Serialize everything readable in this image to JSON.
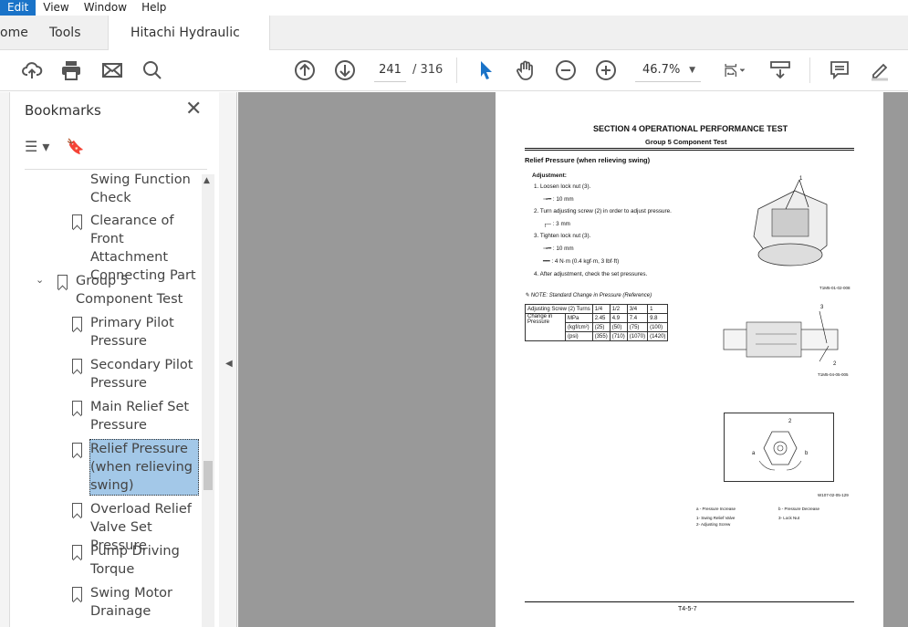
{
  "menu": [
    "Edit",
    "View",
    "Window",
    "Help"
  ],
  "tabs": {
    "home": "ome",
    "tools": "Tools",
    "document": "Hitachi Hydraulic Ex...",
    "close": "×"
  },
  "toolbar": {
    "page_current": "241",
    "page_total": "/ 316",
    "zoom": "46.7%"
  },
  "bookmarks": {
    "title": "Bookmarks",
    "close": "✕",
    "items": [
      "Swing Function Check",
      "Clearance of Front Attachment Connecting Part",
      "Group 5 Component Test",
      "Primary Pilot Pressure",
      "Secondary Pilot Pressure",
      "Main Relief Set Pressure",
      "Relief Pressure (when relieving swing)",
      "Overload Relief Valve Set Pressure",
      "Pump Driving Torque",
      "Swing Motor Drainage"
    ]
  },
  "page": {
    "section": "SECTION 4 OPERATIONAL PERFORMANCE TEST",
    "group": "Group 5 Component Test",
    "heading": "Relief Pressure (when relieving swing)",
    "adjustment": "Adjustment:",
    "steps": [
      "1.  Loosen lock nut (3).",
      ": 10 mm",
      "2.  Turn adjusting screw (2) in order to adjust pressure.",
      ": 3 mm",
      "3.  Tighten lock nut (3).",
      ": 10 mm",
      ": 4 N·m (0.4 kgf·m, 3 lbf·ft)",
      "4.  After adjustment, check the set pressures."
    ],
    "note": "NOTE:    Standard Change in Pressure (Reference)",
    "table": {
      "header": [
        "Adjusting Screw (2) Turns",
        "1/4",
        "1/2",
        "3/4",
        "1"
      ],
      "label": "Change in Pressure",
      "rows": [
        [
          "MPa",
          "2.45",
          "4.9",
          "7.4",
          "9.8"
        ],
        [
          "(kgf/cm²)",
          "(25)",
          "(50)",
          "(75)",
          "(100)"
        ],
        [
          "(psi)",
          "(355)",
          "(710)",
          "(1070)",
          "(1420)"
        ]
      ]
    },
    "fig_ids": [
      "T1M5-01-02-008",
      "T1M5-04-05-005",
      "W107-02-05-129"
    ],
    "callouts": [
      "1",
      "1",
      "3",
      "2",
      "2",
      "a",
      "b"
    ],
    "legend": [
      "a -   Pressure Increase",
      "b -   Pressure Decrease",
      "1-    Swing Relief Valve",
      "3-    Lock Nut",
      "2-    Adjusting Screw"
    ],
    "footer": "T4-5-7"
  }
}
